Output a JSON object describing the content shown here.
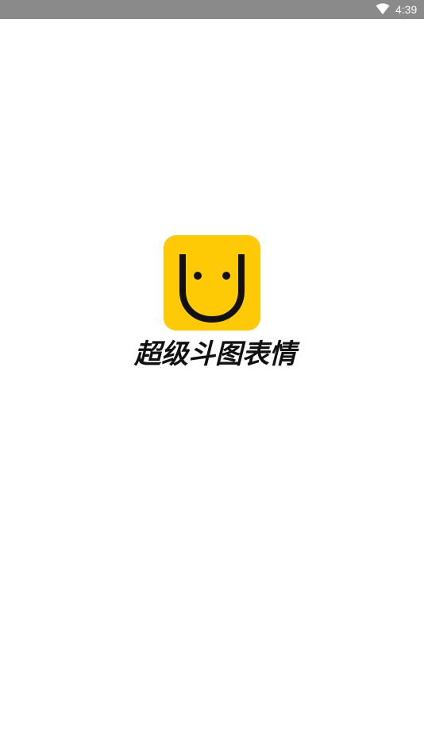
{
  "status_bar": {
    "time": "4:39",
    "wifi_icon": "wifi-icon"
  },
  "splash": {
    "logo_icon": "smiley-face-icon",
    "app_name": "超级斗图表情",
    "logo_color": "#fec905"
  }
}
